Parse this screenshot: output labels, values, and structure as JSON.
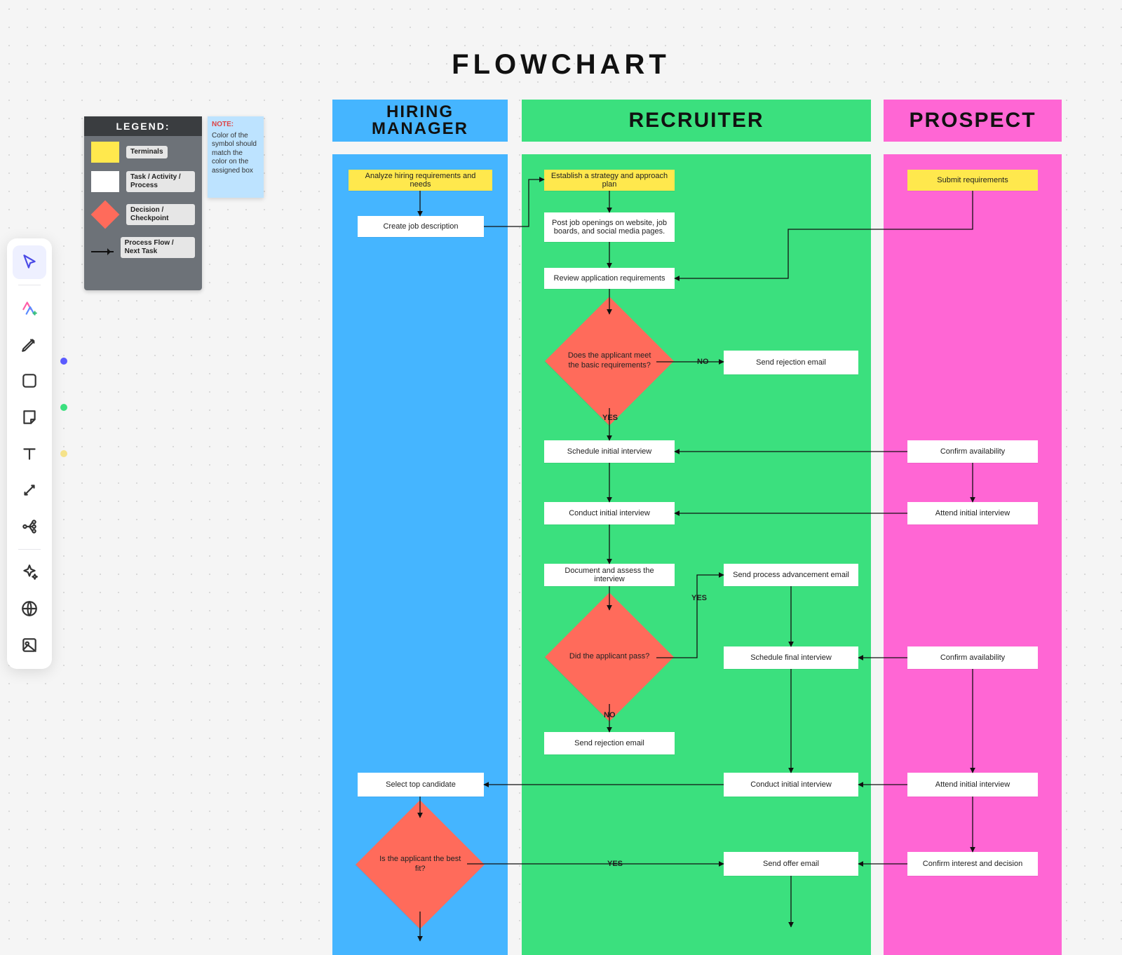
{
  "title": "FLOWCHART",
  "toolbar": {
    "items": [
      {
        "name": "select-tool",
        "selected": true
      },
      {
        "name": "ai-tool"
      },
      {
        "name": "pen-tool"
      },
      {
        "name": "shape-tool"
      },
      {
        "name": "sticky-note-tool"
      },
      {
        "name": "text-tool"
      },
      {
        "name": "connector-tool"
      },
      {
        "name": "mindmap-tool"
      },
      {
        "name": "sparkle-tool"
      },
      {
        "name": "globe-tool"
      },
      {
        "name": "image-tool"
      }
    ]
  },
  "legend": {
    "header": "LEGEND:",
    "rows": [
      {
        "label": "Terminals"
      },
      {
        "label": "Task / Activity / Process"
      },
      {
        "label": "Decision / Checkpoint"
      },
      {
        "label": "Process Flow / Next Task"
      }
    ]
  },
  "note": {
    "title": "NOTE:",
    "body": "Color of the symbol should match the color on the assigned box"
  },
  "lanes": {
    "hiring_manager": {
      "title_line1": "HIRING",
      "title_line2": "MANAGER"
    },
    "recruiter": {
      "title": "RECRUITER"
    },
    "prospect": {
      "title": "PROSPECT"
    }
  },
  "nodes": {
    "hm_analyze": "Analyze hiring requirements and needs",
    "hm_create_jd": "Create job description",
    "hm_select_top": "Select top candidate",
    "hm_best_fit": "Is the applicant the best fit?",
    "rc_strategy": "Establish a strategy and approach plan",
    "rc_post": "Post job openings on website, job boards, and social media pages.",
    "rc_review": "Review application requirements",
    "rc_basic_req": "Does the applicant meet the basic requirements?",
    "rc_reject1": "Send rejection email",
    "rc_sched_init": "Schedule initial interview",
    "rc_conduct_init": "Conduct initial interview",
    "rc_doc_assess": "Document and assess the interview",
    "rc_advance": "Send process advancement email",
    "rc_pass": "Did the applicant pass?",
    "rc_sched_final": "Schedule final interview",
    "rc_reject2": "Send rejection email",
    "rc_conduct_final": "Conduct initial interview",
    "rc_offer": "Send offer email",
    "pr_submit": "Submit requirements",
    "pr_avail1": "Confirm availability",
    "pr_attend1": "Attend initial interview",
    "pr_avail2": "Confirm availability",
    "pr_attend2": "Attend initial interview",
    "pr_decision": "Confirm interest and decision"
  },
  "labels": {
    "no": "NO",
    "yes": "YES"
  }
}
